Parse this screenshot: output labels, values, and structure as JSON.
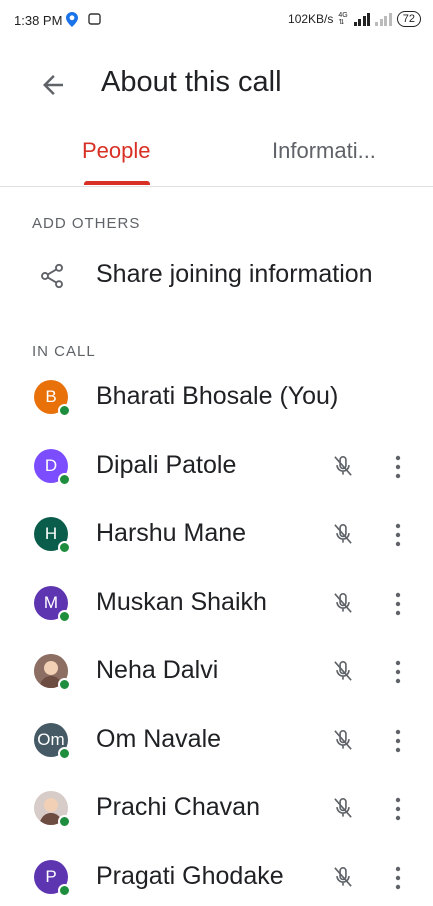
{
  "status_bar": {
    "time": "1:38 PM",
    "speed": "102KB/s",
    "network": "4G",
    "battery": "72"
  },
  "header": {
    "title": "About this call",
    "back_icon": "arrow-back-icon"
  },
  "tabs": [
    {
      "label": "People",
      "active": true
    },
    {
      "label": "Informati..."
    }
  ],
  "add_others": {
    "heading": "ADD OTHERS",
    "share_label": "Share joining information",
    "share_icon": "share-icon"
  },
  "in_call": {
    "heading": "IN CALL",
    "participants": [
      {
        "name": "Bharati Bhosale (You)",
        "initial": "B",
        "color": "#e8710a",
        "muted": false
      },
      {
        "name": "Dipali Patole",
        "initial": "D",
        "color": "#7c4dff",
        "muted": true
      },
      {
        "name": "Harshu Mane",
        "initial": "H",
        "color": "#0b5d4b",
        "muted": true
      },
      {
        "name": "Muskan Shaikh",
        "initial": "M",
        "color": "#5e35b1",
        "muted": true
      },
      {
        "name": "Neha Dalvi",
        "initial": "",
        "color": "#8d6e63",
        "muted": true,
        "photo": true
      },
      {
        "name": "Om Navale",
        "initial": "Om",
        "color": "#455a64",
        "muted": true
      },
      {
        "name": "Prachi Chavan",
        "initial": "",
        "color": "#d7ccc8",
        "muted": true,
        "photo": true
      },
      {
        "name": "Pragati Ghodake",
        "initial": "P",
        "color": "#5e35b1",
        "muted": true
      }
    ]
  },
  "colors": {
    "accent": "#d93025",
    "online": "#1e8e3e"
  }
}
